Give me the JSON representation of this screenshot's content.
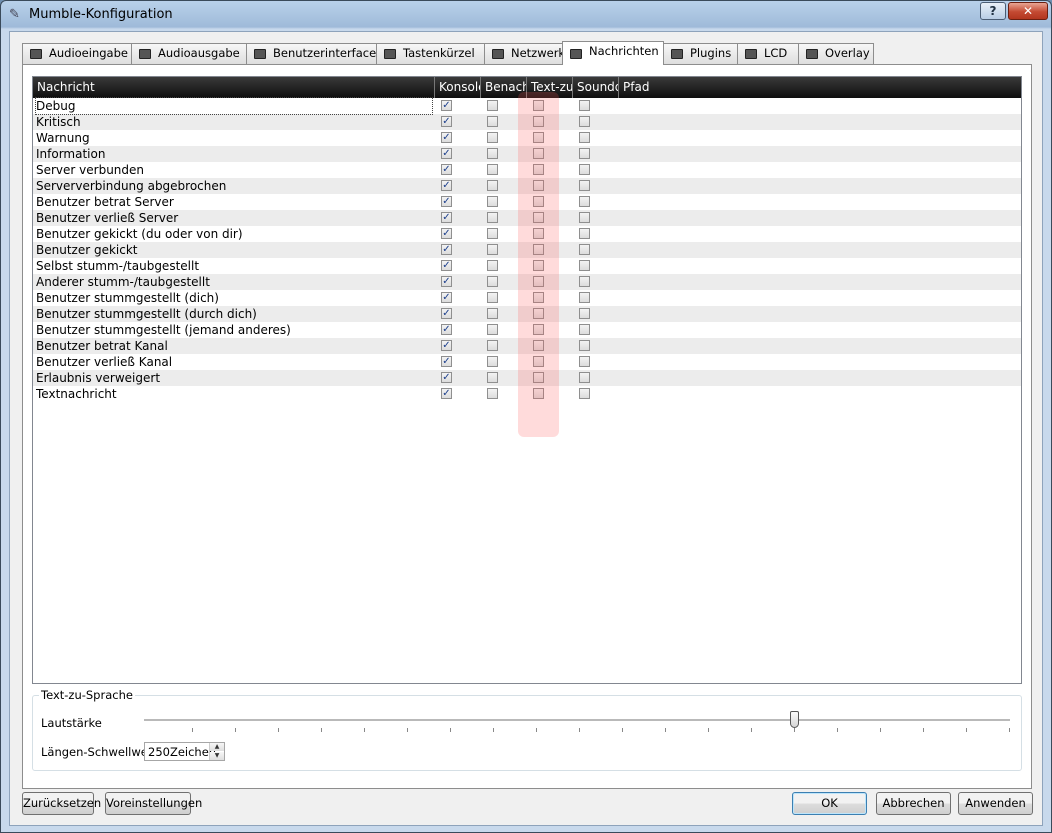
{
  "window": {
    "title": "Mumble-Konfiguration",
    "help_label": "?",
    "close_label": "✕"
  },
  "tabs": [
    {
      "label": "Audioeingabe",
      "icon": "microphone-icon"
    },
    {
      "label": "Audioausgabe",
      "icon": "speaker-icon"
    },
    {
      "label": "Benutzerinterface",
      "icon": "window-icon"
    },
    {
      "label": "Tastenkürzel",
      "icon": "keyboard-icon"
    },
    {
      "label": "Netzwerk",
      "icon": "network-icon"
    },
    {
      "label": "Nachrichten",
      "icon": "message-icon",
      "active": true
    },
    {
      "label": "Plugins",
      "icon": "plugin-icon"
    },
    {
      "label": "LCD",
      "icon": "lcd-icon"
    },
    {
      "label": "Overlay",
      "icon": "overlay-icon"
    }
  ],
  "messages_table": {
    "columns": [
      "Nachricht",
      "Konsole",
      "Benach",
      "Text-zu-",
      "Soundd",
      "Pfad"
    ],
    "rows": [
      {
        "label": "Debug",
        "console": true,
        "notify": false,
        "tts": false,
        "sound": false
      },
      {
        "label": "Kritisch",
        "console": true,
        "notify": false,
        "tts": false,
        "sound": false
      },
      {
        "label": "Warnung",
        "console": true,
        "notify": false,
        "tts": false,
        "sound": false
      },
      {
        "label": "Information",
        "console": true,
        "notify": false,
        "tts": false,
        "sound": false
      },
      {
        "label": "Server verbunden",
        "console": true,
        "notify": false,
        "tts": false,
        "sound": false
      },
      {
        "label": "Serververbindung abgebrochen",
        "console": true,
        "notify": false,
        "tts": false,
        "sound": false
      },
      {
        "label": "Benutzer betrat Server",
        "console": true,
        "notify": false,
        "tts": false,
        "sound": false
      },
      {
        "label": "Benutzer verließ Server",
        "console": true,
        "notify": false,
        "tts": false,
        "sound": false
      },
      {
        "label": "Benutzer gekickt (du oder von dir)",
        "console": true,
        "notify": false,
        "tts": false,
        "sound": false
      },
      {
        "label": "Benutzer gekickt",
        "console": true,
        "notify": false,
        "tts": false,
        "sound": false
      },
      {
        "label": "Selbst stumm-/taubgestellt",
        "console": true,
        "notify": false,
        "tts": false,
        "sound": false
      },
      {
        "label": "Anderer stumm-/taubgestellt",
        "console": true,
        "notify": false,
        "tts": false,
        "sound": false
      },
      {
        "label": "Benutzer stummgestellt (dich)",
        "console": true,
        "notify": false,
        "tts": false,
        "sound": false
      },
      {
        "label": "Benutzer stummgestellt (durch dich)",
        "console": true,
        "notify": false,
        "tts": false,
        "sound": false
      },
      {
        "label": "Benutzer stummgestellt (jemand anderes)",
        "console": true,
        "notify": false,
        "tts": false,
        "sound": false
      },
      {
        "label": "Benutzer betrat Kanal",
        "console": true,
        "notify": false,
        "tts": false,
        "sound": false
      },
      {
        "label": "Benutzer verließ Kanal",
        "console": true,
        "notify": false,
        "tts": false,
        "sound": false
      },
      {
        "label": "Erlaubnis verweigert",
        "console": true,
        "notify": false,
        "tts": false,
        "sound": false
      },
      {
        "label": "Textnachricht",
        "console": true,
        "notify": false,
        "tts": false,
        "sound": false
      }
    ]
  },
  "tts": {
    "group_title": "Text-zu-Sprache",
    "volume_label": "Lautstärke",
    "volume_fraction": 0.75,
    "threshold_label": "Längen-Schwellwert",
    "threshold_value": "250Zeichen"
  },
  "buttons": {
    "reset": "Zurücksetzen",
    "defaults": "Voreinstellungen",
    "ok": "OK",
    "cancel": "Abbrechen",
    "apply": "Anwenden"
  }
}
